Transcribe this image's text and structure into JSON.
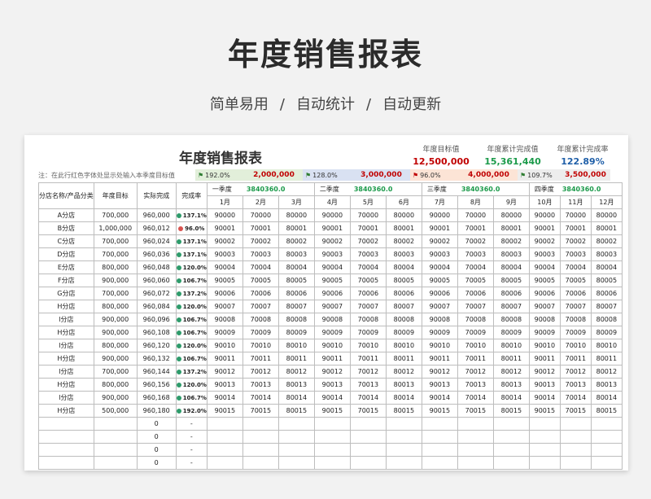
{
  "page": {
    "title": "年度销售报表",
    "subtitle_items": [
      "简单易用",
      "自动统计",
      "自动更新"
    ],
    "subtitle_sep": "/"
  },
  "sheet": {
    "title": "年度销售报表",
    "summary": [
      {
        "label": "年度目标值",
        "value": "12,500,000",
        "color": "#c00000"
      },
      {
        "label": "年度累计完成值",
        "value": "15,361,440",
        "color": "#1b9a4a"
      },
      {
        "label": "年度累计完成率",
        "value": "122.89%",
        "color": "#1f5fa8"
      }
    ],
    "note": "注：在此行红色字体处显示处输入本季度目标值",
    "quarter_strip": [
      {
        "pct": "192.0%",
        "target": "2,000,000",
        "bg": "#e2efda"
      },
      {
        "pct": "128.0%",
        "target": "3,000,000",
        "bg": "#d9e1f2"
      },
      {
        "pct": "96.0%",
        "target": "4,000,000",
        "bg": "#fce4d6"
      },
      {
        "pct": "109.7%",
        "target": "3,500,000",
        "bg": "#ededed"
      }
    ],
    "headers": {
      "store": "分店名称/产品分类",
      "target": "年度目标",
      "actual": "实际完成",
      "rate": "完成率"
    },
    "quarters": [
      {
        "name": "一季度",
        "total": "3840360.0"
      },
      {
        "name": "二季度",
        "total": "3840360.0"
      },
      {
        "name": "三季度",
        "total": "3840360.0"
      },
      {
        "name": "四季度",
        "total": "3840360.0"
      }
    ],
    "months": [
      "1月",
      "2月",
      "3月",
      "4月",
      "5月",
      "6月",
      "7月",
      "8月",
      "9月",
      "10月",
      "11月",
      "12月"
    ],
    "rows": [
      {
        "store": "A分店",
        "target": "700,000",
        "actual": "960,000",
        "rate": "137.1%",
        "status": "green",
        "m": [
          "90000",
          "70000",
          "80000",
          "90000",
          "70000",
          "80000",
          "90000",
          "70000",
          "80000",
          "90000",
          "70000",
          "80000"
        ]
      },
      {
        "store": "B分店",
        "target": "1,000,000",
        "actual": "960,012",
        "rate": "96.0%",
        "status": "red",
        "m": [
          "90001",
          "70001",
          "80001",
          "90001",
          "70001",
          "80001",
          "90001",
          "70001",
          "80001",
          "90001",
          "70001",
          "80001"
        ]
      },
      {
        "store": "C分店",
        "target": "700,000",
        "actual": "960,024",
        "rate": "137.1%",
        "status": "green",
        "m": [
          "90002",
          "70002",
          "80002",
          "90002",
          "70002",
          "80002",
          "90002",
          "70002",
          "80002",
          "90002",
          "70002",
          "80002"
        ]
      },
      {
        "store": "D分店",
        "target": "700,000",
        "actual": "960,036",
        "rate": "137.1%",
        "status": "green",
        "m": [
          "90003",
          "70003",
          "80003",
          "90003",
          "70003",
          "80003",
          "90003",
          "70003",
          "80003",
          "90003",
          "70003",
          "80003"
        ]
      },
      {
        "store": "E分店",
        "target": "800,000",
        "actual": "960,048",
        "rate": "120.0%",
        "status": "green",
        "m": [
          "90004",
          "70004",
          "80004",
          "90004",
          "70004",
          "80004",
          "90004",
          "70004",
          "80004",
          "90004",
          "70004",
          "80004"
        ]
      },
      {
        "store": "F分店",
        "target": "900,000",
        "actual": "960,060",
        "rate": "106.7%",
        "status": "green",
        "m": [
          "90005",
          "70005",
          "80005",
          "90005",
          "70005",
          "80005",
          "90005",
          "70005",
          "80005",
          "90005",
          "70005",
          "80005"
        ]
      },
      {
        "store": "G分店",
        "target": "700,000",
        "actual": "960,072",
        "rate": "137.2%",
        "status": "green",
        "m": [
          "90006",
          "70006",
          "80006",
          "90006",
          "70006",
          "80006",
          "90006",
          "70006",
          "80006",
          "90006",
          "70006",
          "80006"
        ]
      },
      {
        "store": "H分店",
        "target": "800,000",
        "actual": "960,084",
        "rate": "120.0%",
        "status": "green",
        "m": [
          "90007",
          "70007",
          "80007",
          "90007",
          "70007",
          "80007",
          "90007",
          "70007",
          "80007",
          "90007",
          "70007",
          "80007"
        ]
      },
      {
        "store": "I分店",
        "target": "900,000",
        "actual": "960,096",
        "rate": "106.7%",
        "status": "green",
        "m": [
          "90008",
          "70008",
          "80008",
          "90008",
          "70008",
          "80008",
          "90008",
          "70008",
          "80008",
          "90008",
          "70008",
          "80008"
        ]
      },
      {
        "store": "H分店",
        "target": "900,000",
        "actual": "960,108",
        "rate": "106.7%",
        "status": "green",
        "m": [
          "90009",
          "70009",
          "80009",
          "90009",
          "70009",
          "80009",
          "90009",
          "70009",
          "80009",
          "90009",
          "70009",
          "80009"
        ]
      },
      {
        "store": "I分店",
        "target": "800,000",
        "actual": "960,120",
        "rate": "120.0%",
        "status": "green",
        "m": [
          "90010",
          "70010",
          "80010",
          "90010",
          "70010",
          "80010",
          "90010",
          "70010",
          "80010",
          "90010",
          "70010",
          "80010"
        ]
      },
      {
        "store": "H分店",
        "target": "900,000",
        "actual": "960,132",
        "rate": "106.7%",
        "status": "green",
        "m": [
          "90011",
          "70011",
          "80011",
          "90011",
          "70011",
          "80011",
          "90011",
          "70011",
          "80011",
          "90011",
          "70011",
          "80011"
        ]
      },
      {
        "store": "I分店",
        "target": "700,000",
        "actual": "960,144",
        "rate": "137.2%",
        "status": "green",
        "m": [
          "90012",
          "70012",
          "80012",
          "90012",
          "70012",
          "80012",
          "90012",
          "70012",
          "80012",
          "90012",
          "70012",
          "80012"
        ]
      },
      {
        "store": "H分店",
        "target": "800,000",
        "actual": "960,156",
        "rate": "120.0%",
        "status": "green",
        "m": [
          "90013",
          "70013",
          "80013",
          "90013",
          "70013",
          "80013",
          "90013",
          "70013",
          "80013",
          "90013",
          "70013",
          "80013"
        ]
      },
      {
        "store": "I分店",
        "target": "900,000",
        "actual": "960,168",
        "rate": "106.7%",
        "status": "green",
        "m": [
          "90014",
          "70014",
          "80014",
          "90014",
          "70014",
          "80014",
          "90014",
          "70014",
          "80014",
          "90014",
          "70014",
          "80014"
        ]
      },
      {
        "store": "H分店",
        "target": "500,000",
        "actual": "960,180",
        "rate": "192.0%",
        "status": "green",
        "m": [
          "90015",
          "70015",
          "80015",
          "90015",
          "70015",
          "80015",
          "90015",
          "70015",
          "80015",
          "90015",
          "70015",
          "80015"
        ]
      },
      {
        "store": "",
        "target": "",
        "actual": "0",
        "rate": "-",
        "status": "none",
        "m": [
          "",
          "",
          "",
          "",
          "",
          "",
          "",
          "",
          "",
          "",
          "",
          ""
        ]
      },
      {
        "store": "",
        "target": "",
        "actual": "0",
        "rate": "-",
        "status": "none",
        "m": [
          "",
          "",
          "",
          "",
          "",
          "",
          "",
          "",
          "",
          "",
          "",
          ""
        ]
      },
      {
        "store": "",
        "target": "",
        "actual": "0",
        "rate": "-",
        "status": "none",
        "m": [
          "",
          "",
          "",
          "",
          "",
          "",
          "",
          "",
          "",
          "",
          "",
          ""
        ]
      },
      {
        "store": "",
        "target": "",
        "actual": "0",
        "rate": "-",
        "status": "none",
        "m": [
          "",
          "",
          "",
          "",
          "",
          "",
          "",
          "",
          "",
          "",
          "",
          ""
        ]
      }
    ]
  }
}
